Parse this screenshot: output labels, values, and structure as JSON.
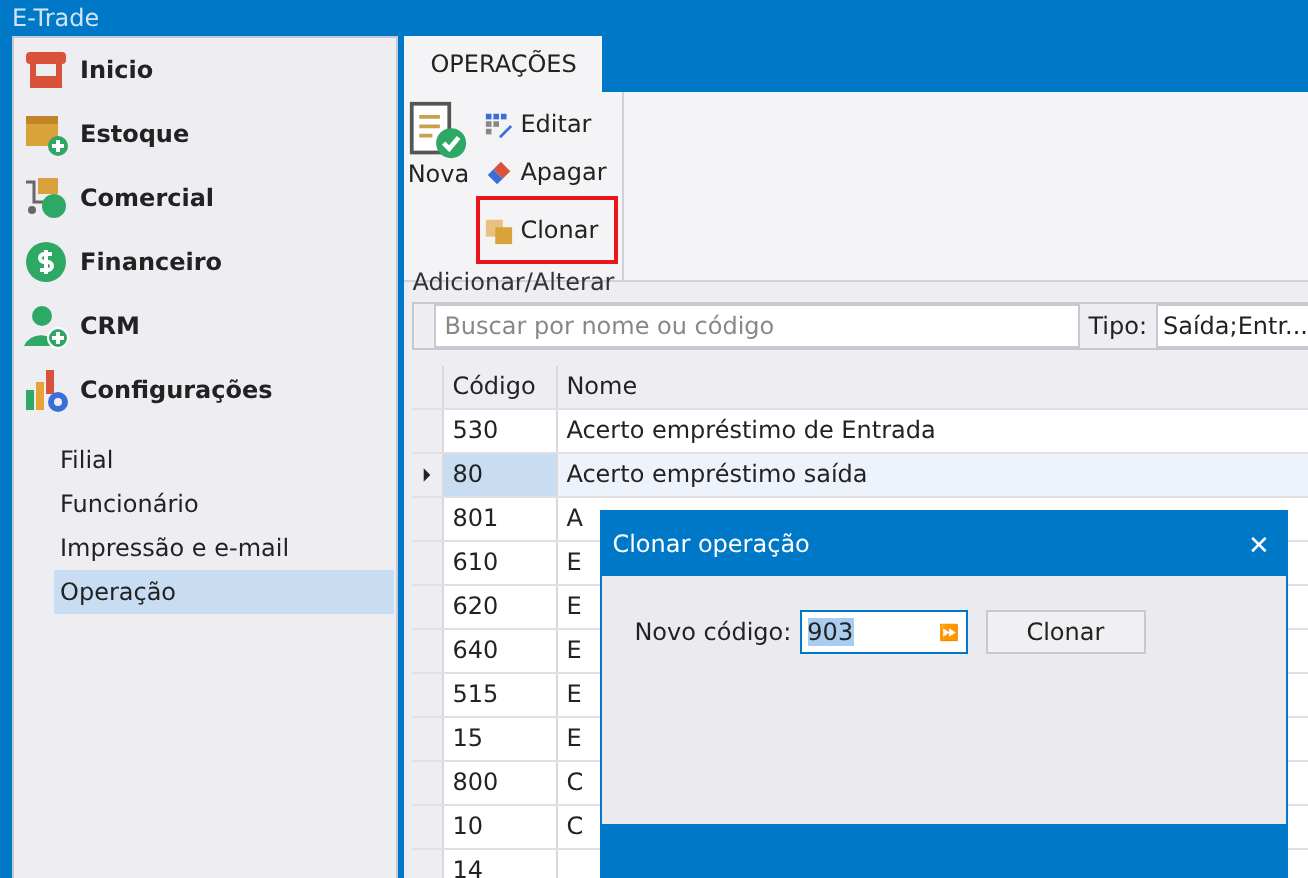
{
  "window": {
    "title": "E-Trade"
  },
  "modules": [
    {
      "label": "Inicio",
      "kind": "store"
    },
    {
      "label": "Estoque",
      "kind": "stock"
    },
    {
      "label": "Comercial",
      "kind": "cart"
    },
    {
      "label": "Financeiro",
      "kind": "money"
    },
    {
      "label": "CRM",
      "kind": "person"
    },
    {
      "label": "Configurações",
      "kind": "chart"
    }
  ],
  "submenu": [
    {
      "label": "Filial",
      "selected": false
    },
    {
      "label": "Funcionário",
      "selected": false
    },
    {
      "label": "Impressão e e-mail",
      "selected": false
    },
    {
      "label": "Operação",
      "selected": true
    }
  ],
  "tabs": [
    {
      "label": "OPERAÇÕES",
      "selected": true
    }
  ],
  "ribbon": {
    "group": "Adicionar/Alterar",
    "large_button": {
      "label": "Nova"
    },
    "buttons": [
      {
        "label": "Editar",
        "kind": "grid",
        "highlighted": false
      },
      {
        "label": "Apagar",
        "kind": "eraser",
        "highlighted": false
      },
      {
        "label": "Clonar",
        "kind": "copy",
        "highlighted": true
      }
    ]
  },
  "search": {
    "placeholder": "Buscar por nome ou código",
    "type_label": "Tipo:",
    "type_value": "Saída;Entr..."
  },
  "table": {
    "columns": [
      "Código",
      "Nome"
    ],
    "rows": [
      {
        "code": "530",
        "name": "Acerto empréstimo de Entrada",
        "selected": false
      },
      {
        "code": "80",
        "name": "Acerto empréstimo saída",
        "selected": true
      },
      {
        "code": "801",
        "name": "A",
        "selected": false
      },
      {
        "code": "610",
        "name": "E",
        "selected": false
      },
      {
        "code": "620",
        "name": "E",
        "selected": false
      },
      {
        "code": "640",
        "name": "E",
        "selected": false
      },
      {
        "code": "515",
        "name": "E",
        "selected": false
      },
      {
        "code": "15",
        "name": "E",
        "selected": false
      },
      {
        "code": "800",
        "name": "C",
        "selected": false
      },
      {
        "code": "10",
        "name": "C",
        "selected": false
      },
      {
        "code": "14",
        "selected": false
      }
    ]
  },
  "dialog": {
    "title": "Clonar operação",
    "close": "✕",
    "field_label": "Novo código:",
    "field_value": "903",
    "spin": "⏩",
    "button": "Clonar"
  }
}
